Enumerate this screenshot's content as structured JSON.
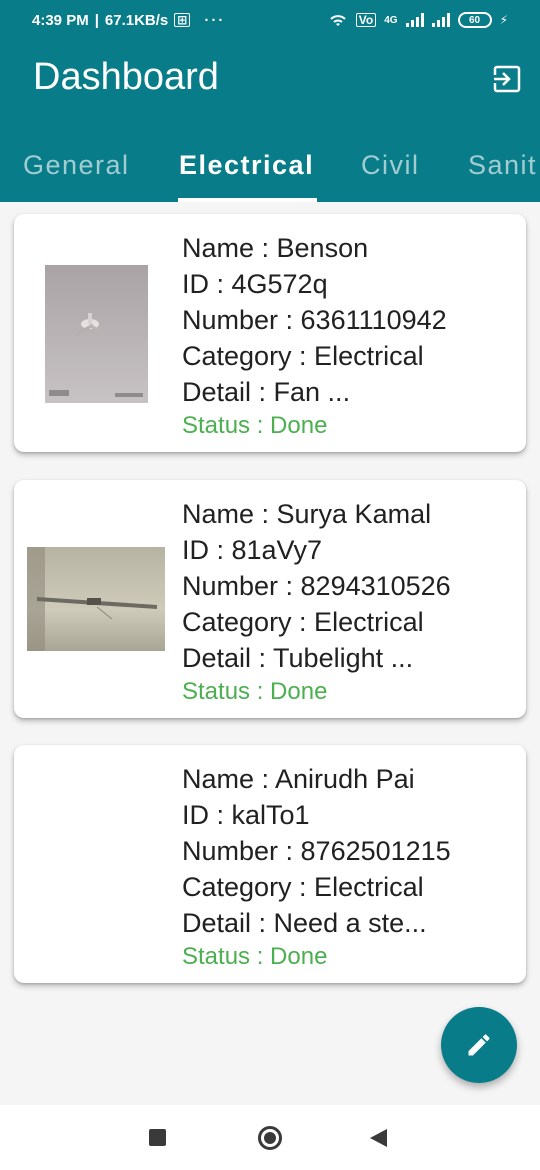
{
  "status_bar": {
    "time": "4:39 PM",
    "speed": "67.1KB/s",
    "more": "···",
    "battery": "60",
    "network": "4G"
  },
  "app_bar": {
    "title": "Dashboard",
    "tabs": [
      {
        "label": "General"
      },
      {
        "label": "Electrical"
      },
      {
        "label": "Civil"
      },
      {
        "label": "Sanit"
      }
    ],
    "active_tab": "Electrical"
  },
  "cards": [
    {
      "name": "Name : Benson",
      "id": "ID : 4G572q",
      "number": "Number : 6361110942",
      "category": "Category : Electrical",
      "detail": "Detail : Fan ...",
      "status": "Status : Done"
    },
    {
      "name": "Name : Surya Kamal",
      "id": "ID : 81aVy7",
      "number": "Number : 8294310526",
      "category": "Category : Electrical",
      "detail": "Detail : Tubelight ...",
      "status": "Status : Done"
    },
    {
      "name": "Name : Anirudh Pai",
      "id": "ID : kalTo1",
      "number": "Number : 8762501215",
      "category": "Category : Electrical",
      "detail": "Detail : Need a ste...",
      "status": "Status : Done"
    }
  ],
  "colors": {
    "primary": "#087c88",
    "status_done": "#4caf50"
  },
  "icons": {
    "logout": "logout-icon",
    "fab": "edit-icon"
  }
}
